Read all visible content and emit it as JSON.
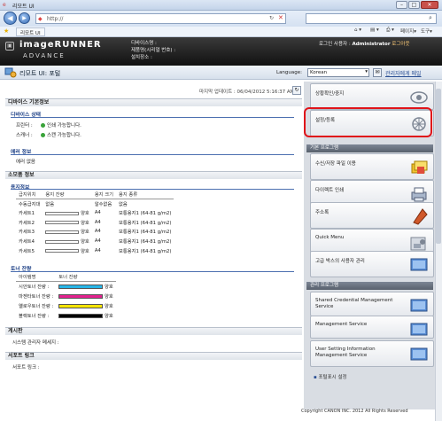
{
  "browser": {
    "tab_title": "리모트 UI",
    "address": "http://",
    "fav_tab": "리모트 UI",
    "toolbar_page": "페이지",
    "toolbar_tools": "도구"
  },
  "header": {
    "brand_line1": "imageRUNNER",
    "brand_line2": "ADVANCE",
    "device_name_label": "디바이스명 :",
    "product_label": "제품명(시리얼 번호) :",
    "location_label": "설치장소 :",
    "login_label": "로그인 사용자 :",
    "login_user": "Administrator",
    "logout": "로그아웃"
  },
  "subheader": {
    "title": "리모트 UI: 포털",
    "language_label": "Language:",
    "language_value": "Korean",
    "mail_admin": "관리자에게 메일"
  },
  "updated": "마지막 업데이트 : 06/04/2012 5:16:37 AM",
  "device_basic": {
    "title": "디바이스 기본정보",
    "status_title": "디바이스 상태",
    "printer_label": "프린터 :",
    "printer_status": "인쇄 가능합니다.",
    "scanner_label": "스캐너 :",
    "scanner_status": "스캔 가능합니다.",
    "error_title": "에러 정보",
    "error_text": "에러 없음"
  },
  "consumables": {
    "title": "소모품 정보",
    "paper_title": "용지정보",
    "paper_headers": [
      "급지위치",
      "용지 잔량",
      "용지 크기",
      "용지 종류"
    ],
    "paper_rows": [
      {
        "source": "수동급지대",
        "level": "없음",
        "size": "알수없음",
        "type": "없음",
        "bar": false
      },
      {
        "source": "카세트1",
        "level": "양호",
        "size": "A4",
        "type": "보통용지1 (64-81 g/m2)",
        "bar": true
      },
      {
        "source": "카세트2",
        "level": "양호",
        "size": "A4",
        "type": "보통용지1 (64-81 g/m2)",
        "bar": true
      },
      {
        "source": "카세트3",
        "level": "양호",
        "size": "A4",
        "type": "보통용지1 (64-81 g/m2)",
        "bar": true
      },
      {
        "source": "카세트4",
        "level": "양호",
        "size": "A4",
        "type": "보통용지1 (64-81 g/m2)",
        "bar": true
      },
      {
        "source": "카세트5",
        "level": "양호",
        "size": "A4",
        "type": "보통용지1 (64-81 g/m2)",
        "bar": true
      }
    ],
    "toner_title": "토너 잔량",
    "toner_headers": [
      "아이템명",
      "토너 잔량"
    ],
    "toner_rows": [
      {
        "name": "시안토너 잔량 :",
        "level": "양호",
        "color": "#27b6e8"
      },
      {
        "name": "마젠타토너 잔량 :",
        "level": "양호",
        "color": "#e3228f"
      },
      {
        "name": "옐로우토너 잔량 :",
        "level": "양호",
        "color": "#f5e400"
      },
      {
        "name": "블랙토너 잔량 :",
        "level": "양호",
        "color": "#000000"
      }
    ]
  },
  "board": {
    "title": "게시판",
    "text": "시스템 관리자 메세지 :"
  },
  "support": {
    "title": "서포트 링크",
    "text": "서포트 링크 :"
  },
  "sidebar": {
    "status_monitor": "상황확인/중지",
    "settings": "설정/등록",
    "basic_title": "기본 프로그램",
    "basic_items": [
      "수신/저장 파일 이용",
      "다이렉트 인쇄",
      "주소록",
      "Quick Menu",
      "고급 박스의 사용자 관리"
    ],
    "admin_title": "관리 프로그램",
    "admin_items": [
      "Shared Credential Management Service",
      "Management Service",
      "User Setting Information Management Service"
    ],
    "portal_settings": "포털표시 설정"
  },
  "footer": "Copyright CANON INC. 2012 All Rights Reserved"
}
